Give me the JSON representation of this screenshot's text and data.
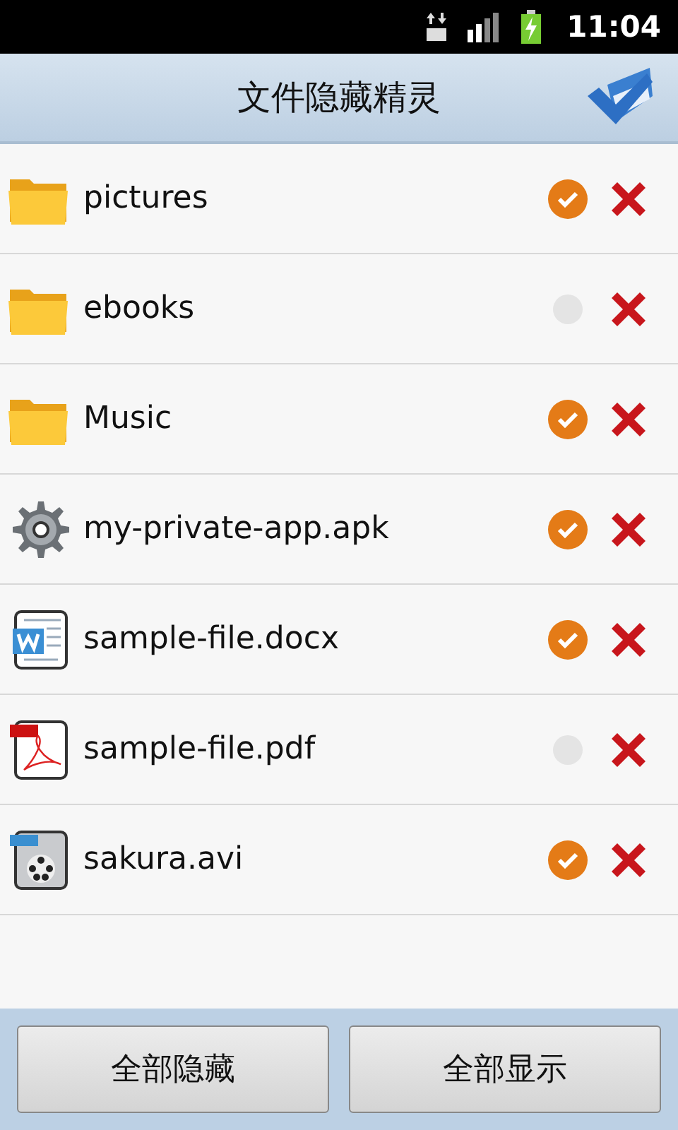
{
  "status_bar": {
    "time": "11:04"
  },
  "header": {
    "title": "文件隐藏精灵"
  },
  "files": [
    {
      "kind": "folder",
      "name": "pictures",
      "checked": true
    },
    {
      "kind": "folder",
      "name": "ebooks",
      "checked": false
    },
    {
      "kind": "folder",
      "name": "Music",
      "checked": true
    },
    {
      "kind": "app",
      "name": "my-private-app.apk",
      "checked": true
    },
    {
      "kind": "doc",
      "name": "sample-file.docx",
      "checked": true
    },
    {
      "kind": "pdf",
      "name": "sample-file.pdf",
      "checked": false
    },
    {
      "kind": "video",
      "name": "sakura.avi",
      "checked": true
    }
  ],
  "buttons": [
    "全部隐藏",
    "全部显示"
  ]
}
